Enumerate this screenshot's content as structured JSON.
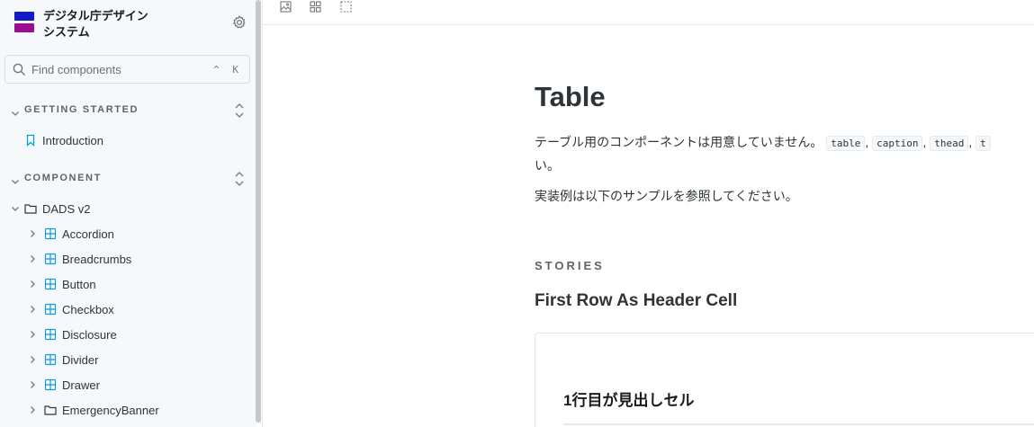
{
  "brand": {
    "line1": "デジタル庁デザイン",
    "line2": "システム"
  },
  "search": {
    "placeholder": "Find components",
    "shortcut": "^ K"
  },
  "sections": [
    {
      "label": "GETTING STARTED"
    },
    {
      "label": "COMPONENT"
    }
  ],
  "getting_started": {
    "introduction": "Introduction"
  },
  "tree": {
    "root": "DADS v2",
    "items": [
      "Accordion",
      "Breadcrumbs",
      "Button",
      "Checkbox",
      "Disclosure",
      "Divider",
      "Drawer",
      "EmergencyBanner"
    ]
  },
  "doc": {
    "title": "Table",
    "para1_prefix": "テーブル用のコンポーネントは用意していません。",
    "codes": [
      "table",
      "caption",
      "thead",
      "t"
    ],
    "para1_tail": "い。",
    "para2": "実装例は以下のサンプルを参照してください。",
    "stories_label": "STORIES",
    "story_title": "First Row As Header Cell",
    "caption": "1行目が見出しセル"
  },
  "colors": {
    "accent": "#0e9bd4",
    "logo_top": "#1418c8",
    "logo_bottom": "#9a0f8e"
  }
}
